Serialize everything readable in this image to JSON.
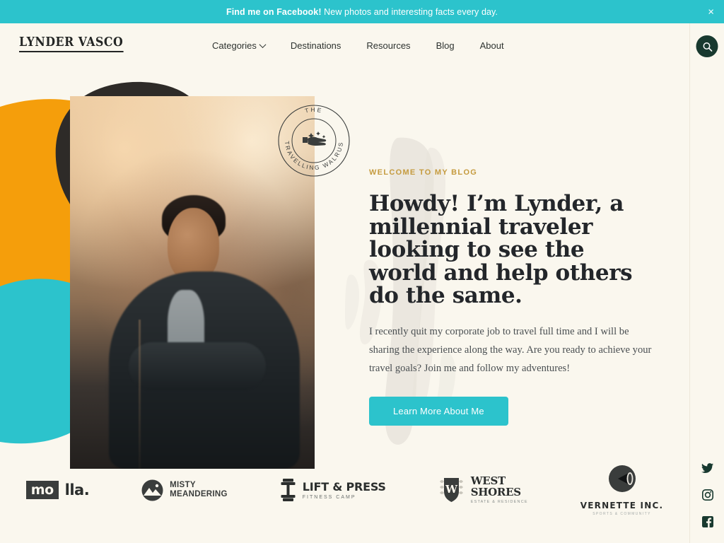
{
  "announcement": {
    "bold_text": "Find me on Facebook!",
    "rest_text": " New photos and interesting facts every day.",
    "close_label": "×",
    "background_color": "#2CC3CC"
  },
  "header": {
    "logo": "LYNDER VASCO",
    "nav": [
      {
        "label": "Categories",
        "has_chevron": true
      },
      {
        "label": "Destinations",
        "has_chevron": false
      },
      {
        "label": "Resources",
        "has_chevron": false
      },
      {
        "label": "Blog",
        "has_chevron": false
      },
      {
        "label": "About",
        "has_chevron": false
      }
    ],
    "search_icon": "search-icon",
    "search_button_color": "#18392F"
  },
  "hero": {
    "eyebrow": "WELCOME TO MY BLOG",
    "eyebrow_color": "#C59B3F",
    "headline": "Howdy! I’m Lynder, a millennial traveler looking to see the world and help others do the same.",
    "paragraph": "I recently quit my corporate job to travel full time and I will be sharing the experience along the way. Are you ready to achieve your travel goals?  Join me and follow my adventures!",
    "cta_label": "Learn More About Me",
    "cta_color": "#2CC3CC",
    "photo_alt": "smiling-man-portrait",
    "badge": {
      "top_text": "THE",
      "arc_text": "TRAVELLING WALRUS",
      "icon": "pointing-hand-icon"
    },
    "decor_colors": {
      "orange": "#F59E0B",
      "charcoal": "#2E2B28",
      "teal": "#2CC3CC",
      "background": "#FAF7EE"
    }
  },
  "partners": [
    {
      "name": "molla",
      "box_text": "mo",
      "tail_text": "lla.",
      "style": "box"
    },
    {
      "name": "misty-meandering",
      "line1": "MISTY",
      "line2": "MEANDERING",
      "icon": "mountain-circle-icon",
      "style": "icon-two-line"
    },
    {
      "name": "lift-and-press",
      "main": "LIFT & PRESS",
      "sub": "FITNESS CAMP",
      "icon": "dumbbell-icon",
      "style": "icon-main-sub"
    },
    {
      "name": "west-shores",
      "line1": "WEST",
      "line2": "SHORES",
      "sub": "ESTATE & RESIDENCE",
      "icon": "shield-w-icon",
      "style": "shield"
    },
    {
      "name": "vernette-inc",
      "main": "VERNETTE INC.",
      "sub": "SPORTS & COMMUNITY",
      "icon": "megaphone-circle-icon",
      "style": "stacked"
    }
  ],
  "social": [
    {
      "name": "twitter",
      "icon": "twitter-icon"
    },
    {
      "name": "instagram",
      "icon": "instagram-icon"
    },
    {
      "name": "facebook",
      "icon": "facebook-icon"
    }
  ]
}
